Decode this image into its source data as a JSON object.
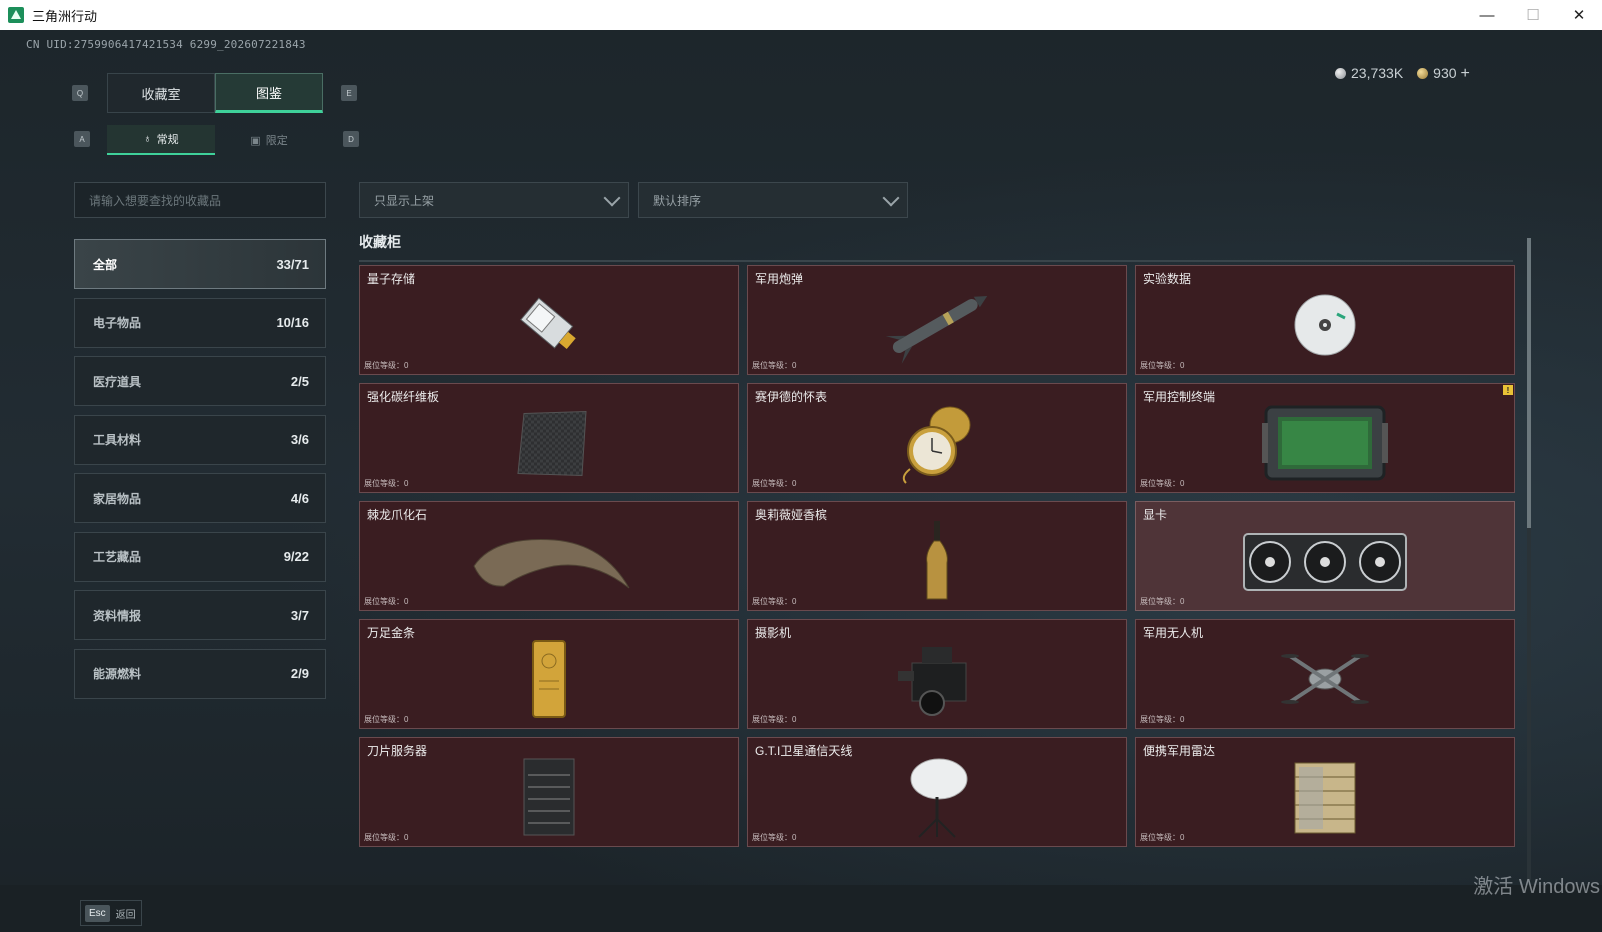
{
  "window": {
    "title": "三角洲行动",
    "minimize": "—",
    "maximize": "☐",
    "close": "✕"
  },
  "uid": "CN UID:2759906417421534 6299_202607221843",
  "currency": {
    "silver": "23,733K",
    "gold": "930",
    "add": "+"
  },
  "keys": {
    "prev_tab": "Q",
    "next_tab": "E",
    "prev_sub": "A",
    "next_sub": "D"
  },
  "tabs": [
    {
      "label": "收藏室"
    },
    {
      "label": "图鉴"
    }
  ],
  "subtabs": [
    {
      "label": "常规"
    },
    {
      "label": "限定"
    }
  ],
  "search": {
    "placeholder": "请输入想要查找的收藏品"
  },
  "filters": {
    "shelf": "只显示上架",
    "sort": "默认排序"
  },
  "categories": [
    {
      "label": "全部",
      "count": "33/71"
    },
    {
      "label": "电子物品",
      "count": "10/16"
    },
    {
      "label": "医疗道具",
      "count": "2/5"
    },
    {
      "label": "工具材料",
      "count": "3/6"
    },
    {
      "label": "家居物品",
      "count": "4/6"
    },
    {
      "label": "工艺藏品",
      "count": "9/22"
    },
    {
      "label": "资料情报",
      "count": "3/7"
    },
    {
      "label": "能源燃料",
      "count": "2/9"
    }
  ],
  "section_title": "收藏柜",
  "level_label": "展位等级：0",
  "items": [
    {
      "name": "量子存储",
      "icon": "usb-drive-icon"
    },
    {
      "name": "军用炮弹",
      "icon": "missile-icon"
    },
    {
      "name": "实验数据",
      "icon": "disc-icon"
    },
    {
      "name": "强化碳纤维板",
      "icon": "carbon-plate-icon"
    },
    {
      "name": "赛伊德的怀表",
      "icon": "pocket-watch-icon"
    },
    {
      "name": "军用控制终端",
      "icon": "tablet-terminal-icon"
    },
    {
      "name": "棘龙爪化石",
      "icon": "claw-fossil-icon"
    },
    {
      "name": "奥莉薇娅香槟",
      "icon": "champagne-icon"
    },
    {
      "name": "显卡",
      "icon": "gpu-icon"
    },
    {
      "name": "万足金条",
      "icon": "gold-bar-icon"
    },
    {
      "name": "摄影机",
      "icon": "camera-icon"
    },
    {
      "name": "军用无人机",
      "icon": "drone-icon"
    },
    {
      "name": "刀片服务器",
      "icon": "server-icon"
    },
    {
      "name": "G.T.I卫星通信天线",
      "icon": "satellite-dish-icon"
    },
    {
      "name": "便携军用雷达",
      "icon": "radar-icon"
    }
  ],
  "bottom": {
    "esc_key": "Esc",
    "back": "返回"
  },
  "watermark": "激活 Windows",
  "colors": {
    "accent": "#3fd19a",
    "card_bg": "#3a1d21",
    "card_border": "#6a4a4e"
  }
}
